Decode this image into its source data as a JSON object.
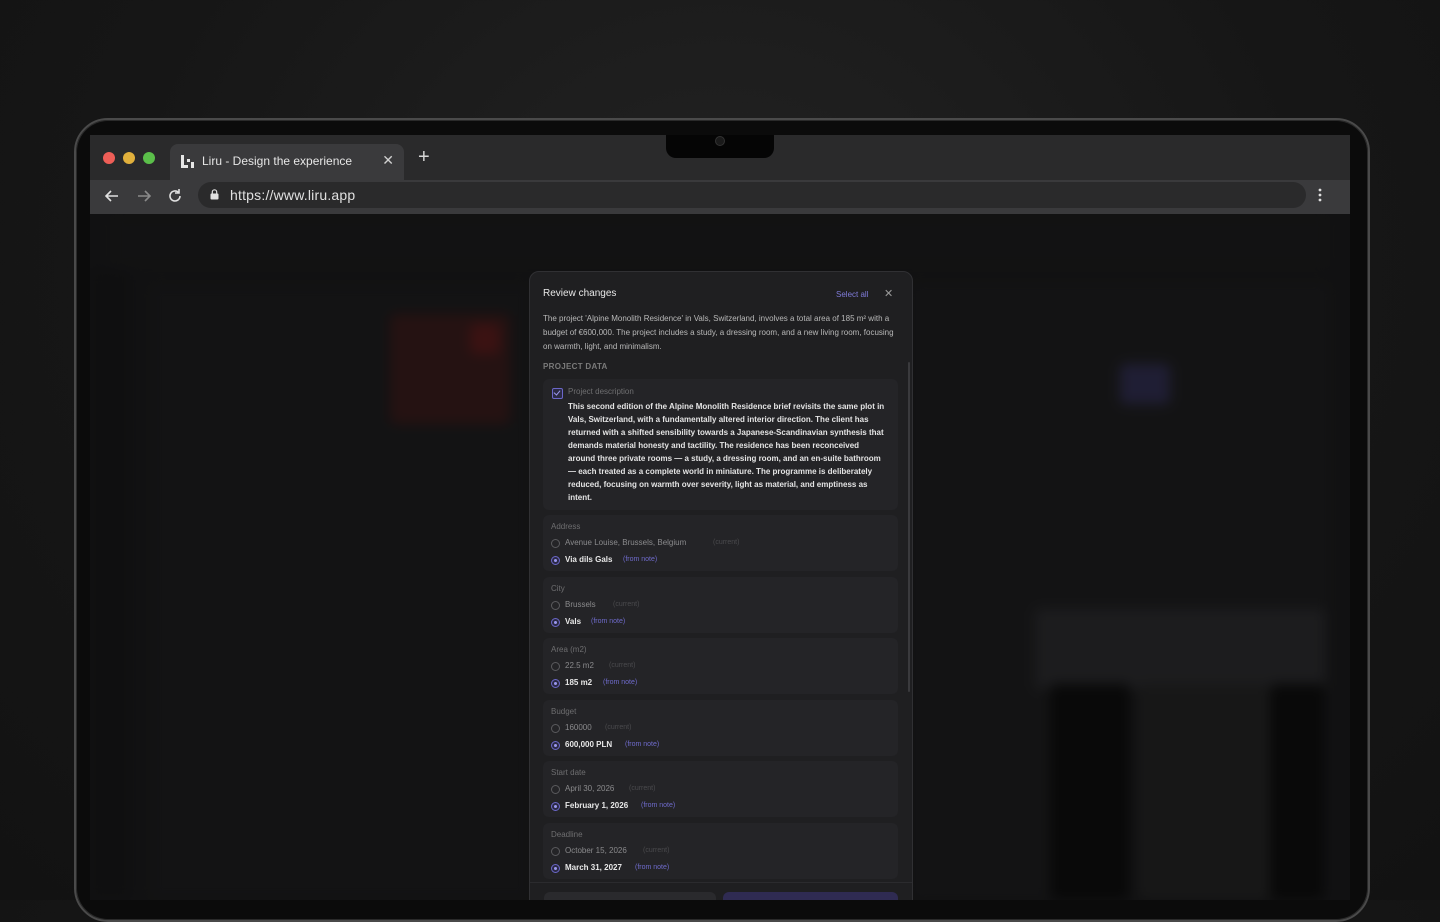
{
  "browser": {
    "tab_title": "Liru - Design the experience",
    "url": "https://www.liru.app"
  },
  "modal": {
    "title": "Review changes",
    "select_all": "Select all",
    "summary": "The project 'Alpine Monolith Residence' in Vals, Switzerland, involves a total area of 185 m² with a budget of €600,000. The project includes a study, a dressing room, and a new living room, focusing on warmth, light, and minimalism.",
    "section_label": "PROJECT DATA",
    "description": {
      "label": "Project description",
      "text": "This second edition of the Alpine Monolith Residence brief revisits the same plot in Vals, Switzerland, with a fundamentally altered interior direction. The client has returned with a shifted sensibility towards a Japanese-Scandinavian synthesis that demands material honesty and tactility. The residence has been reconceived around three private rooms — a study, a dressing room, and an en-suite bathroom — each treated as a complete world in miniature. The programme is deliberately reduced, focusing on warmth over severity, light as material, and emptiness as intent."
    },
    "current_tag": "(current)",
    "note_tag": "(from note)",
    "fields": [
      {
        "label": "Address",
        "current": "Avenue Louise, Brussels, Belgium",
        "new": "Via dils Gals"
      },
      {
        "label": "City",
        "current": "Brussels",
        "new": "Vals"
      },
      {
        "label": "Area (m2)",
        "current": "22.5 m2",
        "new": "185 m2"
      },
      {
        "label": "Budget",
        "current": "160000",
        "new": "600,000 PLN"
      },
      {
        "label": "Start date",
        "current": "April 30, 2026",
        "new": "February 1, 2026"
      },
      {
        "label": "Deadline",
        "current": "October 15, 2026",
        "new": "March 31, 2027"
      }
    ]
  },
  "icons": {
    "close": "close-icon",
    "back": "arrow-left-icon",
    "forward": "arrow-right-icon",
    "reload": "reload-icon",
    "lock": "lock-icon",
    "menu": "more-vertical-icon",
    "logo": "liru-logo-icon"
  },
  "colors": {
    "accent": "#7f7bd9",
    "modal_bg": "#1f1f21",
    "chrome_bg": "#3a3a3c"
  }
}
